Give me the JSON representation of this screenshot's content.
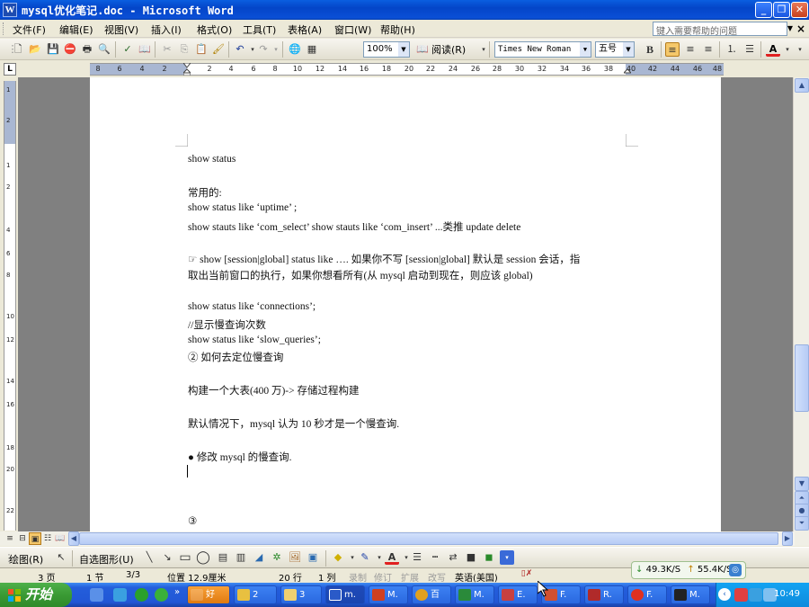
{
  "window": {
    "title": "mysql优化笔记.doc - Microsoft Word",
    "app_icon": "W"
  },
  "menu": {
    "items": [
      "文件(F)",
      "编辑(E)",
      "视图(V)",
      "插入(I)",
      "格式(O)",
      "工具(T)",
      "表格(A)",
      "窗口(W)",
      "帮助(H)"
    ],
    "help_placeholder": "键入需要帮助的问题"
  },
  "toolbar": {
    "zoom": "100%",
    "read_label": "阅读(R)",
    "font_name": "Times New Roman",
    "font_size": "五号",
    "bold_label": "B",
    "font_color_label": "A"
  },
  "ruler": {
    "corner": "L",
    "ticks": [
      "8",
      "6",
      "4",
      "2",
      "2",
      "4",
      "6",
      "8",
      "10",
      "12",
      "14",
      "16",
      "18",
      "20",
      "22",
      "24",
      "26",
      "28",
      "30",
      "32",
      "34",
      "36",
      "38",
      "40",
      "42",
      "44",
      "46",
      "48"
    ],
    "vticks": [
      "1",
      "2",
      "1",
      "2",
      "4",
      "6",
      "8",
      "10",
      "12",
      "14",
      "16",
      "18",
      "20",
      "22"
    ]
  },
  "document": {
    "lines": [
      "show status",
      "常用的:",
      "show status like ‘uptime’ ;",
      "show    stauts like ‘com_select’    show stauts like ‘com_insert’ ...类推  update    delete",
      "☞  show [session|global] status like ….  如果你不写    [session|global]  默认是 session  会话，指",
      "取出当前窗口的执行，如果你想看所有(从 mysql  启动到现在，则应该  global)",
      "show status like ‘connections’;",
      "//显示慢查询次数",
      "show status like ‘slow_queries’;",
      "②  如何去定位慢查询",
      "构建一个大表(400  万)-> 存储过程构建",
      "默认情况下，mysql 认为 10 秒才是一个慢查询.",
      "●    修改 mysql 的慢查询.",
      "③"
    ]
  },
  "drawing_toolbar": {
    "draw_label": "绘图(R)",
    "autoshape_label": "自选图形(U)"
  },
  "status": {
    "page": "3 页",
    "section": "1 节",
    "page_of": "3/3",
    "position": "位置 12.9厘米",
    "line": "20 行",
    "column": "1 列",
    "rec": "录制",
    "trk": "修订",
    "ext": "扩展",
    "ovr": "改写",
    "language": "英语(美国)"
  },
  "network": {
    "down": "49.3K/S",
    "up": "55.4K/S"
  },
  "taskbar": {
    "start_label": "开始",
    "buttons": [
      "好",
      "2",
      "3",
      "m.",
      "M.",
      "百",
      "M.",
      "E.",
      "F.",
      "R.",
      "F.",
      "M."
    ],
    "clock": "10:49"
  }
}
